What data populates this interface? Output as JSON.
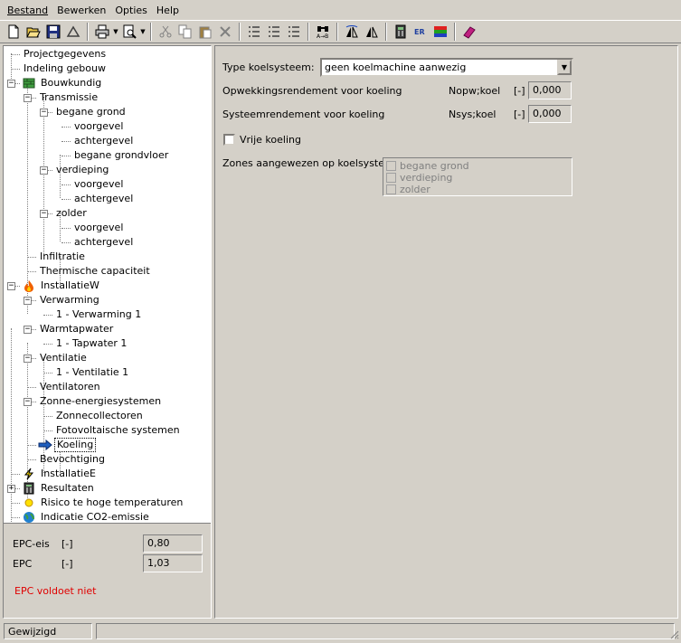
{
  "menu": [
    "Bestand",
    "Bewerken",
    "Opties",
    "Help"
  ],
  "toolbar_icons": [
    "new-file-icon",
    "open-folder-icon",
    "save-icon",
    "recycle-icon",
    "print-icon",
    "print-preview-icon",
    "cut-icon",
    "copy-icon",
    "paste-icon",
    "delete-icon",
    "list-icon-1",
    "list-icon-2",
    "list-icon-3",
    "find-replace-icon",
    "mirror-horizontal-icon",
    "mirror-vertical-icon",
    "calculator-icon",
    "epbd-icon",
    "report-icon",
    "book-icon"
  ],
  "tree": {
    "items": [
      {
        "label": "Projectgegevens",
        "icon": "project-icon"
      },
      {
        "label": "Indeling gebouw",
        "icon": "building-icon"
      },
      {
        "label": "Bouwkundig",
        "icon": "brick-wall-icon"
      },
      {
        "label": "Transmissie"
      },
      {
        "label": "begane grond"
      },
      {
        "label": "voorgevel"
      },
      {
        "label": "achtergevel"
      },
      {
        "label": "begane grondvloer"
      },
      {
        "label": "verdieping"
      },
      {
        "label": "voorgevel"
      },
      {
        "label": "achtergevel"
      },
      {
        "label": "zolder"
      },
      {
        "label": "voorgevel"
      },
      {
        "label": "achtergevel"
      },
      {
        "label": "Infiltratie"
      },
      {
        "label": "Thermische capaciteit"
      },
      {
        "label": "InstallatieW",
        "icon": "flame-icon"
      },
      {
        "label": "Verwarming"
      },
      {
        "label": "1 - Verwarming 1"
      },
      {
        "label": "Warmtapwater"
      },
      {
        "label": "1 - Tapwater 1"
      },
      {
        "label": "Ventilatie"
      },
      {
        "label": "1 - Ventilatie 1"
      },
      {
        "label": "Ventilatoren"
      },
      {
        "label": "Zonne-energiesystemen"
      },
      {
        "label": "Zonnecollectoren"
      },
      {
        "label": "Fotovoltaische systemen"
      },
      {
        "label": "Koeling",
        "icon": "arrow-right-icon"
      },
      {
        "label": "Bevochtiging"
      },
      {
        "label": "InstallatieE",
        "icon": "lightning-icon"
      },
      {
        "label": "Resultaten",
        "icon": "calculator-icon"
      },
      {
        "label": "Risico te hoge temperaturen",
        "icon": "sun-icon"
      },
      {
        "label": "Indicatie CO2-emissie",
        "icon": "globe-icon"
      }
    ]
  },
  "epc": {
    "eis_label": "EPC-eis",
    "eis_unit": "[-]",
    "eis_value": "0,80",
    "epc_label": "EPC",
    "epc_unit": "[-]",
    "epc_value": "1,03",
    "message": "EPC voldoet niet"
  },
  "form": {
    "type_label": "Type koelsysteem:",
    "type_value": "geen koelmachine aanwezig",
    "opw_label": "Opwekkingsrendement voor koeling",
    "opw_symbol": "Nopw;koel",
    "opw_unit": "[-]",
    "opw_value": "0,000",
    "sys_label": "Systeemrendement voor koeling",
    "sys_symbol": "Nsys;koel",
    "sys_unit": "[-]",
    "sys_value": "0,000",
    "vrije_label": "Vrije koeling",
    "zones_label": "Zones aangewezen op koelsysteem:",
    "zones": [
      "begane grond",
      "verdieping",
      "zolder"
    ]
  },
  "status": {
    "text": "Gewijzigd"
  },
  "colors": {
    "error": "#e00000",
    "face": "#d4d0c8",
    "arrow": "#1f5fbf"
  }
}
